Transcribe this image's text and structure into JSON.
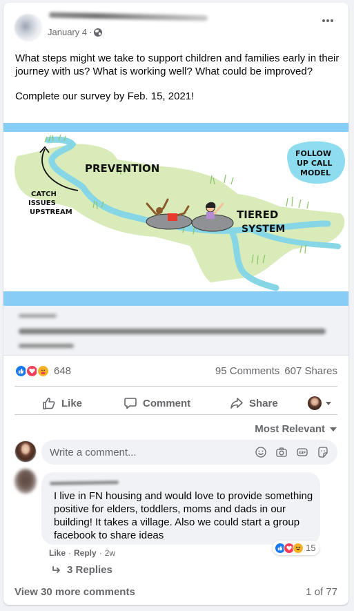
{
  "post": {
    "date": "January 4",
    "separator": "·",
    "privacy_icon": "globe-icon",
    "more_icon": "more-horizontal-icon",
    "text_paragraphs": [
      "What steps might we take to support children and families early in their journey with us? What is working well? What could be improved?",
      "Complete our survey by Feb. 15, 2021!"
    ]
  },
  "illustration": {
    "labels": {
      "prevention": "PREVENTION",
      "catch_1": "CATCH",
      "catch_2": "ISSUES",
      "catch_3": "UPSTREAM",
      "tiered_1": "TIERED",
      "tiered_2": "SYSTEM",
      "follow_1": "FOLLOW",
      "follow_2": "UP CALL",
      "follow_3": "MODEL"
    },
    "colors": {
      "band": "#87cdf5",
      "grass": "#d8ebb9",
      "river": "#86d6e6",
      "bubble": "#8ddcf0"
    }
  },
  "stats": {
    "reaction_icons": [
      "like",
      "love",
      "care"
    ],
    "reaction_count": "648",
    "comments": "95 Comments",
    "shares": "607 Shares"
  },
  "actions": {
    "like": "Like",
    "comment": "Comment",
    "share": "Share"
  },
  "sort": {
    "label": "Most Relevant"
  },
  "composer": {
    "placeholder": "Write a comment...",
    "icons": [
      "emoji-icon",
      "camera-icon",
      "gif-icon",
      "sticker-icon"
    ]
  },
  "comment": {
    "text": "I live in FN housing and would love to provide something positive for elders, toddlers, moms and dads in our building! It takes a village. Also we could start a group facebook to share ideas",
    "reaction_icons": [
      "like",
      "love",
      "haha"
    ],
    "reaction_count": "15",
    "like": "Like",
    "reply": "Reply",
    "time": "2w",
    "dot": "·",
    "replies": "3 Replies"
  },
  "footer": {
    "view_more": "View 30 more comments",
    "page_count": "1 of 77"
  },
  "colors": {
    "background": "#f0f2f5",
    "secondary_text": "#65676b",
    "like_blue": "#1877f2",
    "love_red": "#f33e58",
    "care_yellow": "#f7b125"
  }
}
